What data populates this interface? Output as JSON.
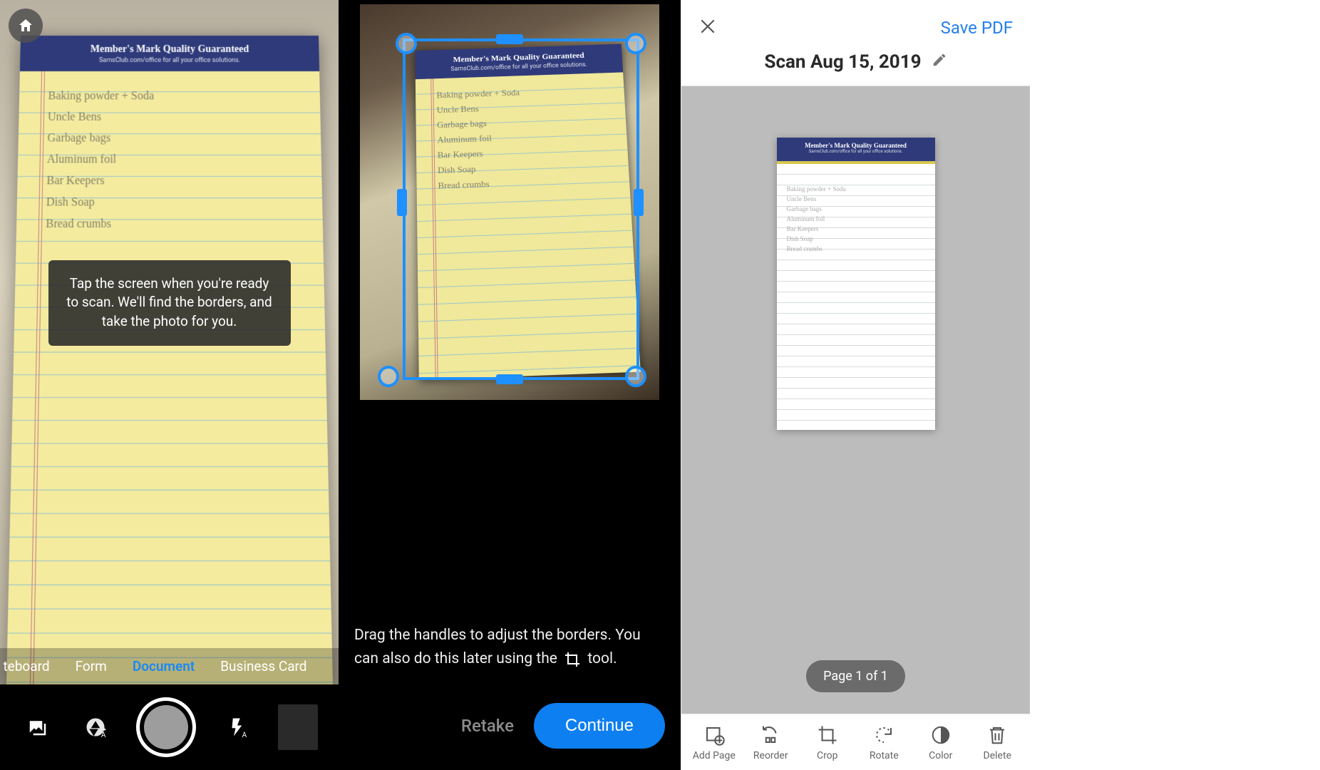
{
  "notepad": {
    "header_title": "Member's Mark Quality Guaranteed",
    "header_sub": "SamsClub.com/office for all your office solutions.",
    "lines": "Baking powder + Soda\nUncle Bens\nGarbage bags\nAluminum foil\nBar Keepers\nDish Soap\nBread crumbs"
  },
  "screen1": {
    "tooltip": "Tap the screen when you're ready to scan. We'll find the borders, and take the photo for you.",
    "categories": {
      "c0": "teboard",
      "c1": "Form",
      "c2": "Document",
      "c3": "Business Card"
    }
  },
  "screen2": {
    "hint_pre": "Drag the handles to adjust the borders. You can also do this later using the ",
    "hint_post": " tool.",
    "retake": "Retake",
    "continue": "Continue"
  },
  "screen3": {
    "save": "Save PDF",
    "title": "Scan Aug 15, 2019",
    "page_indicator": "Page 1 of 1",
    "toolbar": {
      "add": "Add Page",
      "reorder": "Reorder",
      "crop": "Crop",
      "rotate": "Rotate",
      "color": "Color",
      "delete": "Delete"
    }
  }
}
